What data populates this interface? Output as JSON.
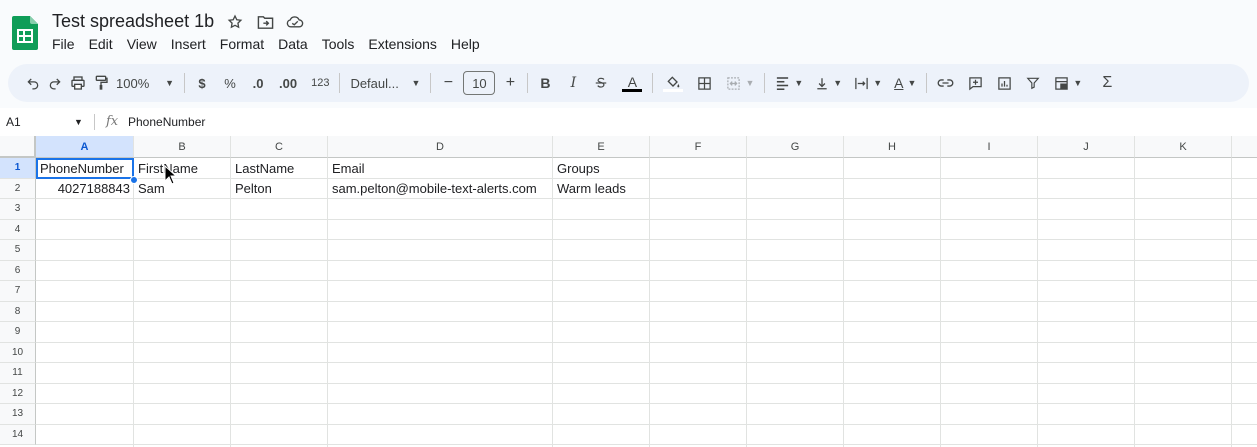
{
  "app": {
    "title": "Test spreadsheet 1b",
    "accent": "#1a73e8",
    "icons": [
      "sheets-logo",
      "star-icon",
      "move-to-folder-icon",
      "cloud-status-icon"
    ]
  },
  "menu": {
    "items": [
      "File",
      "Edit",
      "View",
      "Insert",
      "Format",
      "Data",
      "Tools",
      "Extensions",
      "Help"
    ]
  },
  "toolbar": {
    "zoom": "100%",
    "currency": "$",
    "percent": "%",
    "decrease_decimal": ".0",
    "increase_decimal": ".00",
    "number_format": "123",
    "font": "Defaul...",
    "font_size": "10",
    "minus": "−",
    "plus": "+",
    "bold": "B",
    "italic": "I",
    "text_color": "A",
    "text_rotation": "A",
    "sum": "Σ"
  },
  "formula_bar": {
    "name_box": "A1",
    "fx": "fx",
    "content": "PhoneNumber"
  },
  "sheet": {
    "columns": [
      "A",
      "B",
      "C",
      "D",
      "E",
      "F",
      "G",
      "H",
      "I",
      "J",
      "K"
    ],
    "rows": [
      "1",
      "2",
      "3",
      "4",
      "5",
      "6",
      "7",
      "8",
      "9",
      "10",
      "11",
      "12",
      "13",
      "14"
    ],
    "selected_cell": "A1",
    "cells": {
      "A1": "PhoneNumber",
      "B1": "FirstName",
      "C1": "LastName",
      "D1": "Email",
      "E1": "Groups",
      "A2": "4027188843",
      "B2": "Sam",
      "C2": "Pelton",
      "D2": "sam.pelton@mobile-text-alerts.com",
      "E2": "Warm leads"
    }
  }
}
